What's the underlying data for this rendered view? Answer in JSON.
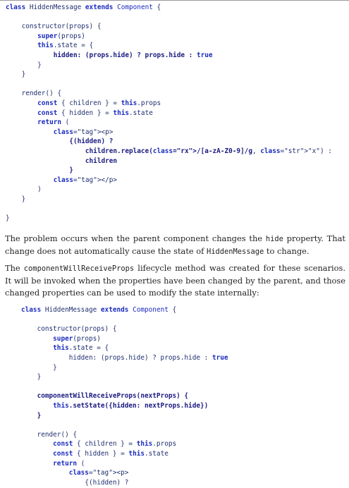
{
  "code_block_1": {
    "lines": [
      "class HiddenMessage extends Component {",
      "",
      "    constructor(props) {",
      "        super(props)",
      "        this.state = {",
      "            hidden: (props.hide) ? props.hide : true",
      "        }",
      "    }",
      "",
      "    render() {",
      "        const { children } = this.props",
      "        const { hidden } = this.state",
      "        return (",
      "            <p>",
      "                {(hidden) ?",
      "                    children.replace(/[a-zA-Z0-9]/g, \"x\") :",
      "                    children",
      "                }",
      "            </p>",
      "        )",
      "    }",
      "",
      "}"
    ]
  },
  "paragraph_1": {
    "part1": "The problem occurs when the parent component changes the ",
    "code1": "hide",
    "part2": " property. That change does not automatically cause the state of ",
    "code2": "HiddenMessage",
    "part3": " to change."
  },
  "paragraph_2": {
    "part1": "The ",
    "code1": "componentWillReceiveProps",
    "part2": " lifecycle method was created for these scenarios. It will be invoked when the properties have been changed by the parent, and those changed properties can be used to modify the state internally:"
  },
  "code_block_2": {
    "lines": [
      "class HiddenMessage extends Component {",
      "",
      "    constructor(props) {",
      "        super(props)",
      "        this.state = {",
      "            hidden: (props.hide) ? props.hide : true",
      "        }",
      "    }",
      "",
      "    componentWillReceiveProps(nextProps) {",
      "        this.setState({hidden: nextProps.hide})",
      "    }",
      "",
      "    render() {",
      "        const { children } = this.props",
      "        const { hidden } = this.state",
      "        return (",
      "            <p>",
      "                {(hidden) ?"
    ]
  }
}
